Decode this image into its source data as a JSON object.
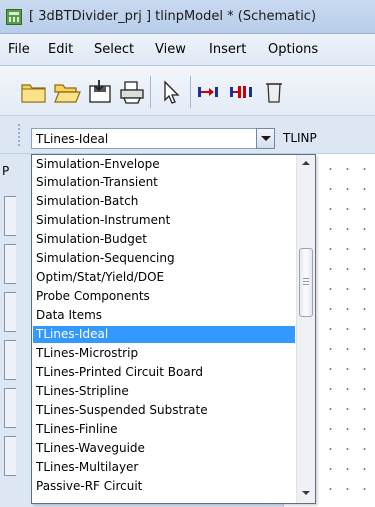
{
  "window": {
    "title": "[ 3dBTDivider_prj ] tlinpModel * (Schematic)",
    "app_icon": "schematic-app-icon"
  },
  "menu": [
    "File",
    "Edit",
    "Select",
    "View",
    "Insert",
    "Options"
  ],
  "toolbar": {
    "buttons": [
      "new-folder-icon",
      "open-folder-icon",
      "save-icon",
      "print-icon",
      "select-pointer-icon",
      "insert-pin-icon",
      "insert-ground-icon",
      "delete-icon"
    ]
  },
  "library": {
    "selected": "TLines-Ideal",
    "component": "TLINP",
    "panel_label": "P"
  },
  "dropdown": {
    "selected_index": 9,
    "items": [
      "Simulation-Envelope",
      "Simulation-Transient",
      "Simulation-Batch",
      "Simulation-Instrument",
      "Simulation-Budget",
      "Simulation-Sequencing",
      "Optim/Stat/Yield/DOE",
      "Probe Components",
      "Data Items",
      "TLines-Ideal",
      "TLines-Microstrip",
      "TLines-Printed Circuit Board",
      "TLines-Stripline",
      "TLines-Suspended Substrate",
      "TLines-Finline",
      "TLines-Waveguide",
      "TLines-Multilayer",
      "Passive-RF Circuit"
    ]
  },
  "colors": {
    "selection": "#3399ff",
    "toolbar_icon": "#f5c84a"
  }
}
